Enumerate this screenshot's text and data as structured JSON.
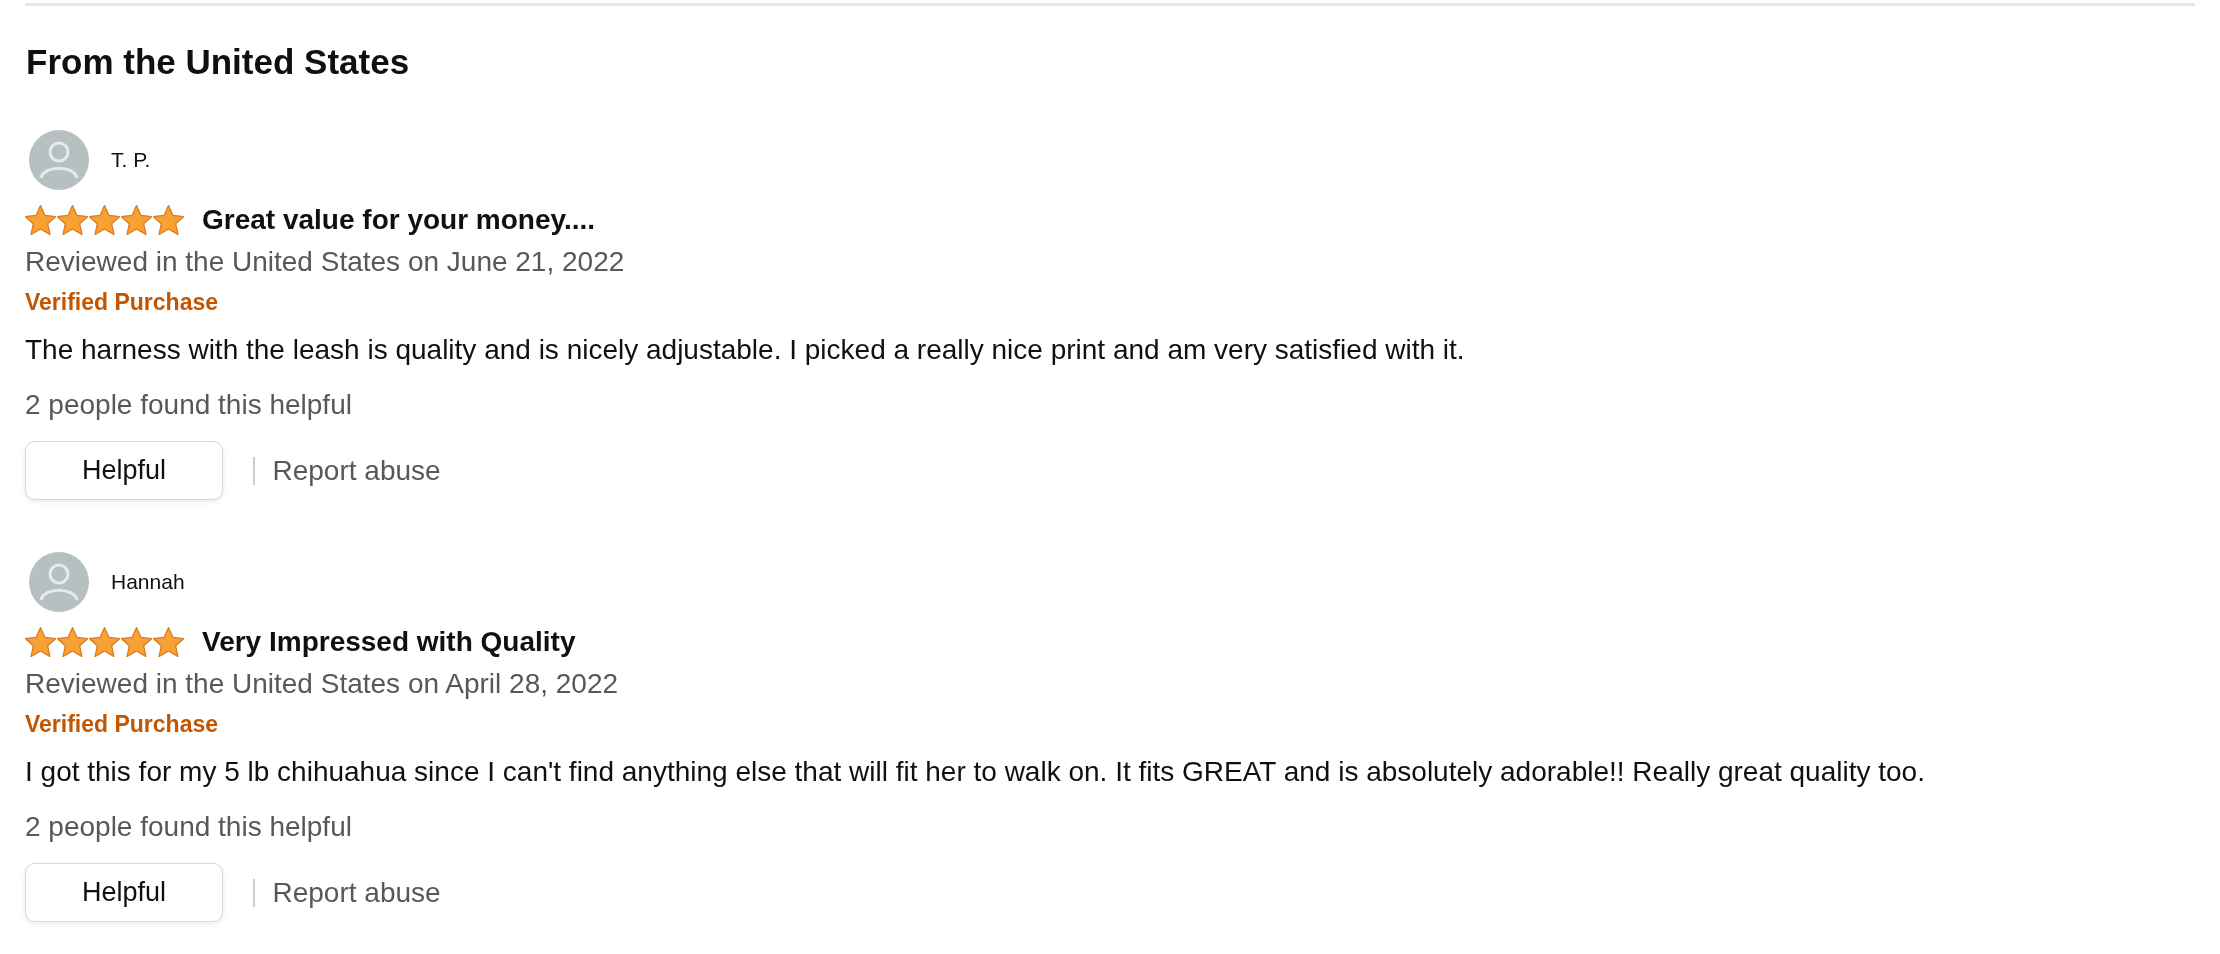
{
  "section_title": "From the United States",
  "reviews": [
    {
      "author": "T. P.",
      "stars": 5,
      "title": "Great value for your money....",
      "date": "Reviewed in the United States on June 21, 2022",
      "badge": "Verified Purchase",
      "body": "The harness with the leash is quality and is nicely adjustable. I picked a really nice print and am very satisfied with it.",
      "helpful_count": "2 people found this helpful",
      "helpful_button": "Helpful",
      "report_link": "Report abuse"
    },
    {
      "author": "Hannah",
      "stars": 5,
      "title": "Very Impressed with Quality",
      "date": "Reviewed in the United States on April 28, 2022",
      "badge": "Verified Purchase",
      "body": "I got this for my 5 lb chihuahua since I can't find anything else that will fit her to walk on. It fits GREAT and is absolutely adorable!! Really great quality too.",
      "helpful_count": "2 people found this helpful",
      "helpful_button": "Helpful",
      "report_link": "Report abuse"
    }
  ]
}
